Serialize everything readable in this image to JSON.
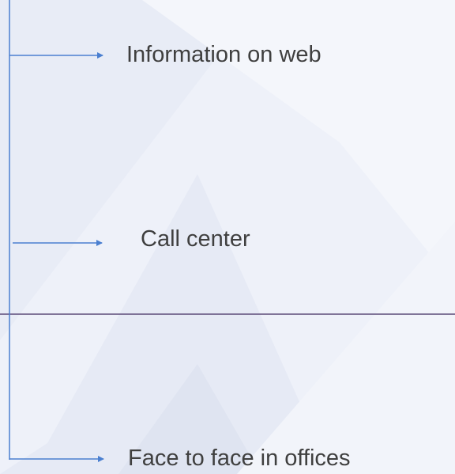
{
  "diagram": {
    "channels": [
      {
        "label": "Information on web"
      },
      {
        "label": "Call center"
      },
      {
        "label": "Face to face in offices"
      }
    ]
  },
  "colors": {
    "background": "#eef1f9",
    "connector": "#4a7fd0",
    "divider": "#5b4a78",
    "text": "#3f3f3f"
  }
}
